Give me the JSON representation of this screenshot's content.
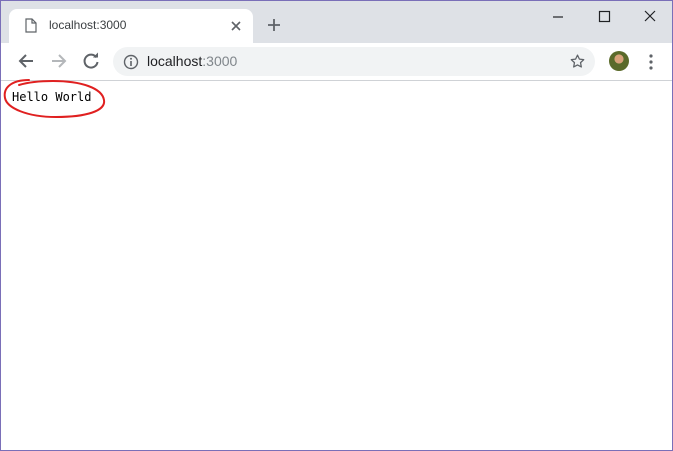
{
  "tab": {
    "title": "localhost:3000"
  },
  "address": {
    "host": "localhost",
    "port": ":3000"
  },
  "page": {
    "text": "Hello World"
  },
  "colors": {
    "annotation": "#e02020",
    "titlebar": "#dee1e6",
    "omnibox": "#f1f3f4"
  },
  "icons": [
    "page-icon",
    "close-icon",
    "plus-icon",
    "minimize-icon",
    "maximize-icon",
    "close-window-icon",
    "back-arrow-icon",
    "forward-arrow-icon",
    "reload-icon",
    "info-icon",
    "star-icon",
    "avatar",
    "kebab-menu-icon"
  ]
}
